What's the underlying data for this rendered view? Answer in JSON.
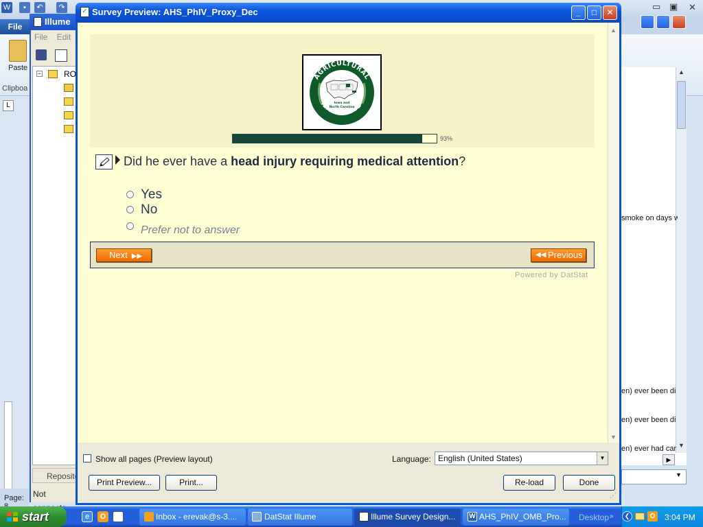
{
  "word": {
    "file_tab": "File",
    "paste_label": "Paste",
    "clipboard_label": "Clipboa",
    "status_text": "Page: 8",
    "doc_lines": [
      "smoke on days w",
      "en) ever been di",
      "en) ever been di",
      "en) ever had car"
    ]
  },
  "illume": {
    "title": "Illume",
    "menu_file": "File",
    "menu_edit": "Edit",
    "tree_root": "RO",
    "repository_tab": "Reposito",
    "status": "Not connecte"
  },
  "dialog": {
    "title": "Survey Preview: AHS_PhIV_Proxy_Dec",
    "minimize": "_",
    "maximize": "□",
    "close": "✕"
  },
  "survey": {
    "logo": {
      "top_text": "AGRICULTURAL",
      "bottom_text": "HEALTH STUDY",
      "inner_line1": "Iowa and",
      "inner_line2": "North Carolina"
    },
    "progress_percent": 93,
    "progress_text": "93%",
    "question_pre": "Did he ever have a ",
    "question_bold": "head injury requiring medical attention",
    "question_post": "?",
    "options": [
      "Yes",
      "No",
      "Prefer not to answer"
    ],
    "next_label": "Next",
    "previous_label": "Previous",
    "powered_by": "Powered by DatStat"
  },
  "footer": {
    "show_all_label": "Show all pages (Preview layout)",
    "language_label": "Language:",
    "language_value": "English (United States)",
    "print_preview": "Print Preview...",
    "print": "Print...",
    "reload": "Re-load",
    "done": "Done"
  },
  "taskbar": {
    "start": "start",
    "tasks": [
      "Inbox - erevak@s-3....",
      "DatStat Illume",
      "Illume Survey Design...",
      "AHS_PhIV_OMB_Pro..."
    ],
    "desktop": "Desktop",
    "clock": "3:04 PM"
  },
  "colors": {
    "content_bg": "#fffed3",
    "header_panel": "#f5f3c6",
    "progress_fill": "#16473a",
    "nav_button": "#ee6a00",
    "xp_blue": "#0a53d6"
  }
}
